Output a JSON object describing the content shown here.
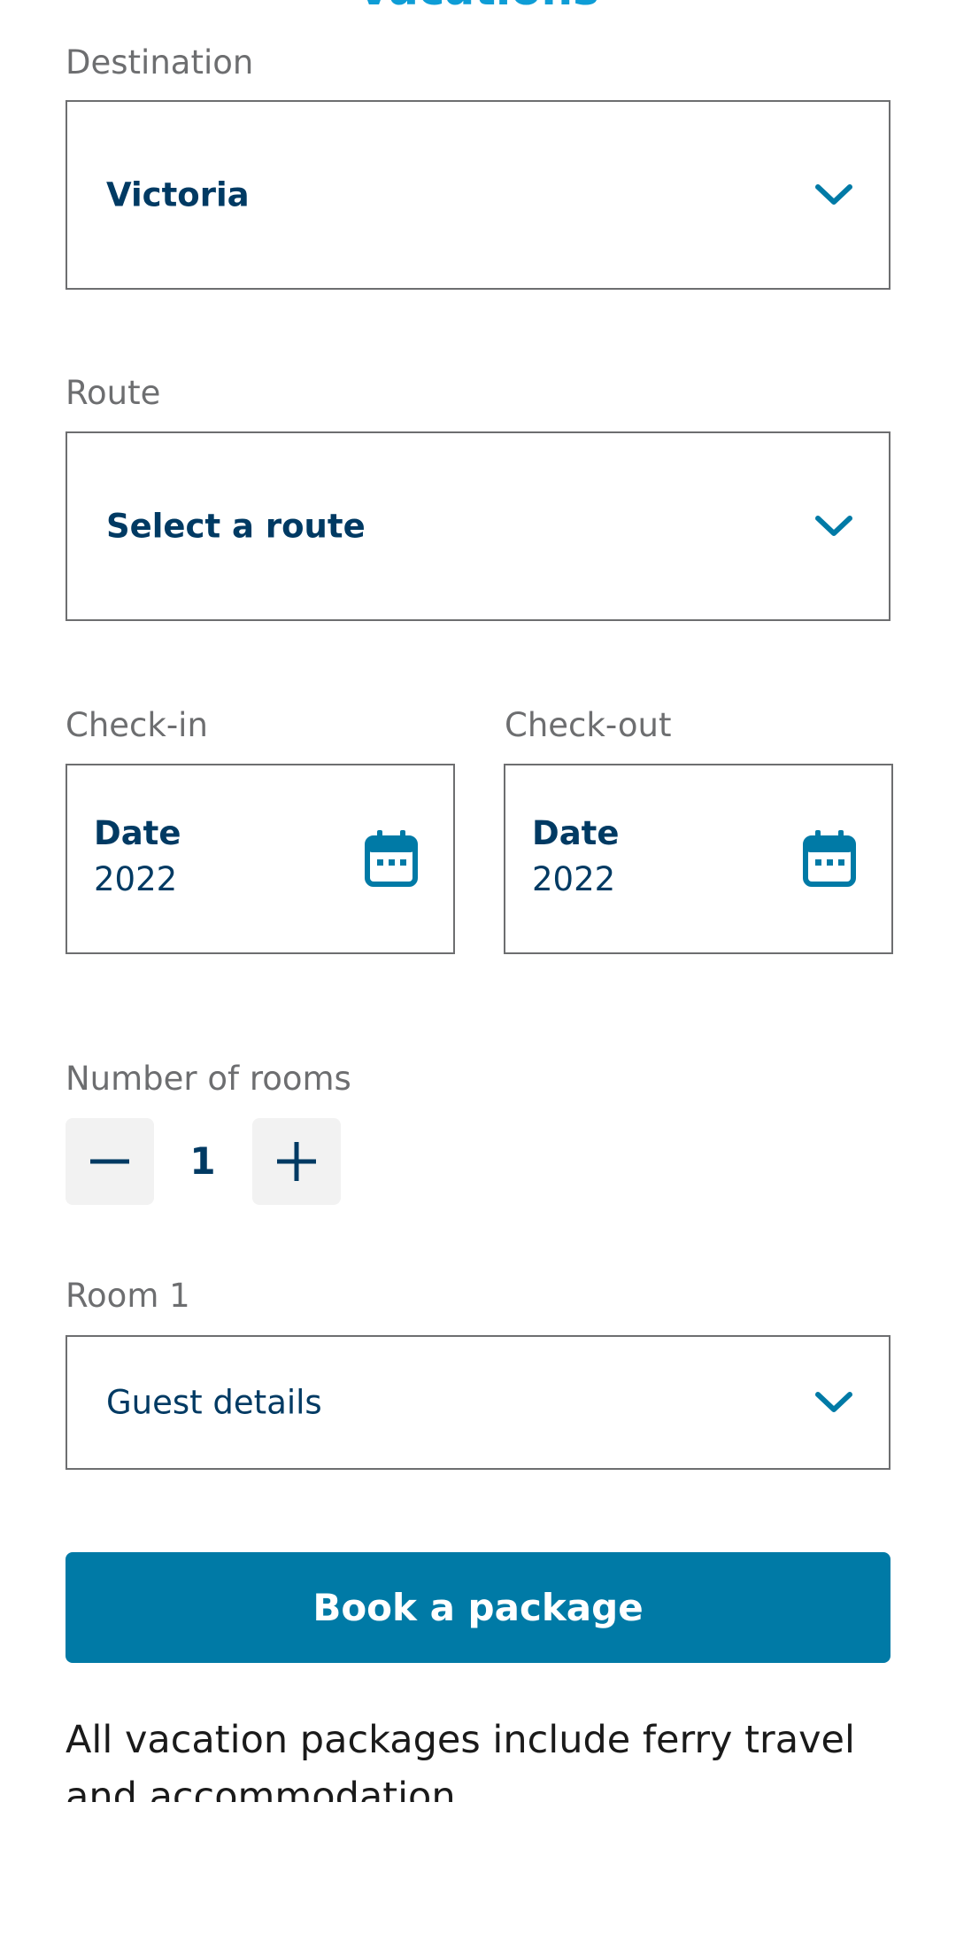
{
  "header": {
    "title": "Vacations"
  },
  "form": {
    "destination": {
      "label": "Destination",
      "value": "Victoria"
    },
    "route": {
      "label": "Route",
      "value": "Select a route"
    },
    "check_in": {
      "label": "Check-in",
      "date_title": "Date",
      "year": "2022"
    },
    "check_out": {
      "label": "Check-out",
      "date_title": "Date",
      "year": "2022"
    },
    "rooms": {
      "label": "Number of rooms",
      "value": "1"
    },
    "room1": {
      "label": "Room 1",
      "value": "Guest details"
    },
    "submit_label": "Book a package"
  },
  "footer": {
    "note": "All vacation packages include ferry travel and accommodation"
  },
  "icons": {
    "chevron": "chevron-down-icon",
    "calendar": "calendar-icon",
    "minus": "minus-icon",
    "plus": "plus-icon"
  },
  "colors": {
    "accent": "#007aa6",
    "text_dark": "#003a63",
    "label_gray": "#6d6e70",
    "title_blue": "#0e9dd6",
    "stepper_bg": "#f2f2f2"
  }
}
